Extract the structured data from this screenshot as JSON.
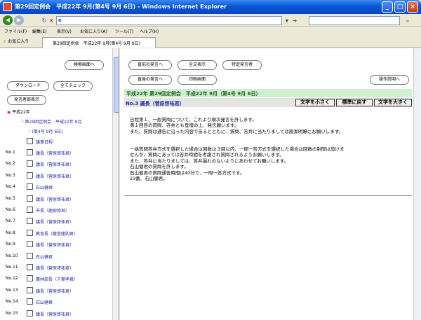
{
  "window": {
    "title": "第29回定例会　平成22年 9月(第4号 9月 6日) - Windows Internet Explorer",
    "controls": [
      "_",
      "□",
      "×"
    ]
  },
  "address": {
    "url": "e"
  },
  "menus": [
    "ファイル(F)",
    "編集(E)",
    "表示(V)",
    "お気に入り(A)",
    "ツール(T)",
    "ヘルプ(H)"
  ],
  "favorites_label": "お気に入り",
  "tab_label": "第29回定例会　平成22年 9月(第4号 9月 6日)",
  "left": {
    "btn_search": "検索画面へ",
    "btn_download": "ダウンロード",
    "btn_check_all": "全てチェック",
    "btn_speaker_list": "発言者部表示",
    "tree": {
      "year": "平成22年",
      "session": "第29回定例会　平成22年 9月",
      "issue": "(第4号 9月 6日)",
      "schedule": "議事日程"
    },
    "speakers": [
      {
        "no": "No.1",
        "name": "議長（菅原啓祐君）"
      },
      {
        "no": "No.2",
        "name": "議長（菅原啓祐君）"
      },
      {
        "no": "No.3",
        "name": "議長（菅原啓祐君）"
      },
      {
        "no": "No.4",
        "name": "石山健君"
      },
      {
        "no": "No.5",
        "name": "議長（菅原啓祐君）"
      },
      {
        "no": "No.6",
        "name": "市長（鹿部修君）"
      },
      {
        "no": "No.7",
        "name": "議長（菅原啓祐君）"
      },
      {
        "no": "No.8",
        "name": "教育長（藤堂隆則君）"
      },
      {
        "no": "No.9",
        "name": "議長（菅原啓祐君）"
      },
      {
        "no": "No.10",
        "name": "石山健君"
      },
      {
        "no": "No.11",
        "name": "議長（菅原啓祐君）"
      },
      {
        "no": "No.12",
        "name": "農林部長（千葉孝君）"
      },
      {
        "no": "No.13",
        "name": "議長（菅原啓祐君）"
      },
      {
        "no": "No.14",
        "name": "石山健君"
      },
      {
        "no": "No.15",
        "name": "議長（菅原啓祐君）"
      }
    ]
  },
  "right": {
    "btn_prev_speech": "直前の発言へ",
    "btn_full_text": "全文表示",
    "btn_specific_speaker": "特定発言者",
    "btn_next_speech": "直後の発言へ",
    "btn_print": "印刷画面",
    "btn_help": "操作説明へ",
    "session_title": "平成22年 第29回定例会　平成22年 9月（第4号 9月 6日）",
    "speaker_heading": "No.3 議長（菅原啓祐君）",
    "btn_text_smaller": "文字を小さく",
    "btn_text_reset": "標準に戻す",
    "btn_text_larger": "文字を大きく",
    "paragraphs": [
      "日程第１、一般質問について、これより順次発言を許します。",
      "第１回目の質問、答弁とも登壇の上、発言願います。",
      "また、質問は通告に沿った内容であるとともに、質問、答弁に当たりましては簡潔明瞭にお願いします。",
      "一括質問答弁方式を選択した場合は回数は３回以内、一問一答方式を選択した場合は回数の制限は設けま",
      "せんが、質問にあっては答弁時間を考慮され質問されるようお願いします。",
      "また、答弁に当たりましては、答弁漏れのないようにあわせてお願いします。",
      "石山健君の質問を許します。",
      "石山健君の質問通告時間は40分で、一問一答方式です。",
      "23番、石山健君。"
    ]
  }
}
